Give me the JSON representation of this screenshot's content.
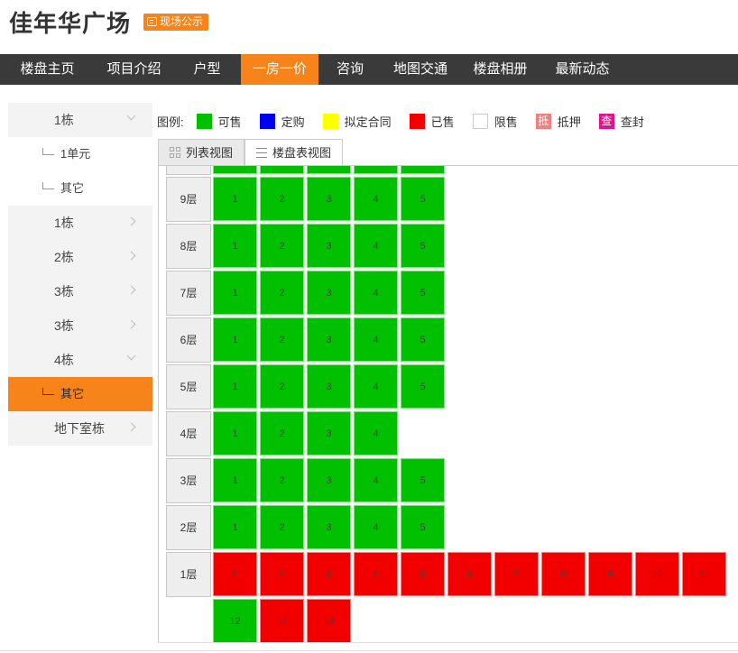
{
  "header": {
    "title": "佳年华广场",
    "badge": "现场公示"
  },
  "nav": [
    "楼盘主页",
    "项目介绍",
    "户型",
    "一房一价",
    "咨询",
    "地图交通",
    "楼盘相册",
    "最新动态"
  ],
  "sidebar": [
    {
      "label": "1栋",
      "type": "building",
      "chevron": "down"
    },
    {
      "label": "1单元",
      "type": "unit"
    },
    {
      "label": "其它",
      "type": "unit"
    },
    {
      "label": "1栋",
      "type": "building",
      "chevron": "right"
    },
    {
      "label": "2栋",
      "type": "building",
      "chevron": "right"
    },
    {
      "label": "3栋",
      "type": "building",
      "chevron": "right"
    },
    {
      "label": "3栋",
      "type": "building",
      "chevron": "right"
    },
    {
      "label": "4栋",
      "type": "building",
      "chevron": "down"
    },
    {
      "label": "其它",
      "type": "unit",
      "active": true
    },
    {
      "label": "地下室栋",
      "type": "building",
      "chevron": "right"
    }
  ],
  "legend": {
    "title": "图例:",
    "items": [
      {
        "label": "可售",
        "color": "#00c000"
      },
      {
        "label": "定购",
        "color": "#0000ee"
      },
      {
        "label": "拟定合同",
        "color": "#ffff00"
      },
      {
        "label": "已售",
        "color": "#f20000"
      },
      {
        "label": "限售",
        "color": "#ffffff"
      },
      {
        "label": "抵押",
        "color": "#f08080",
        "glyph": "抵"
      },
      {
        "label": "查封",
        "color": "#e0158a",
        "glyph": "查"
      }
    ]
  },
  "tabs": [
    "列表视图",
    "楼盘表视图"
  ],
  "floors": [
    {
      "label": "9层",
      "units": [
        {
          "n": "1",
          "s": "green"
        },
        {
          "n": "2",
          "s": "green"
        },
        {
          "n": "3",
          "s": "green"
        },
        {
          "n": "4",
          "s": "green"
        },
        {
          "n": "5",
          "s": "green"
        }
      ]
    },
    {
      "label": "8层",
      "units": [
        {
          "n": "1",
          "s": "green"
        },
        {
          "n": "2",
          "s": "green"
        },
        {
          "n": "3",
          "s": "green"
        },
        {
          "n": "4",
          "s": "green"
        },
        {
          "n": "5",
          "s": "green"
        }
      ]
    },
    {
      "label": "7层",
      "units": [
        {
          "n": "1",
          "s": "green"
        },
        {
          "n": "2",
          "s": "green"
        },
        {
          "n": "3",
          "s": "green"
        },
        {
          "n": "4",
          "s": "green"
        },
        {
          "n": "5",
          "s": "green"
        }
      ]
    },
    {
      "label": "6层",
      "units": [
        {
          "n": "1",
          "s": "green"
        },
        {
          "n": "2",
          "s": "green"
        },
        {
          "n": "3",
          "s": "green"
        },
        {
          "n": "4",
          "s": "green"
        },
        {
          "n": "5",
          "s": "green"
        }
      ]
    },
    {
      "label": "5层",
      "units": [
        {
          "n": "1",
          "s": "green"
        },
        {
          "n": "2",
          "s": "green"
        },
        {
          "n": "3",
          "s": "green"
        },
        {
          "n": "4",
          "s": "green"
        },
        {
          "n": "5",
          "s": "green"
        }
      ]
    },
    {
      "label": "4层",
      "units": [
        {
          "n": "1",
          "s": "green"
        },
        {
          "n": "2",
          "s": "green"
        },
        {
          "n": "3",
          "s": "green"
        },
        {
          "n": "4",
          "s": "green"
        }
      ]
    },
    {
      "label": "3层",
      "units": [
        {
          "n": "1",
          "s": "green"
        },
        {
          "n": "2",
          "s": "green"
        },
        {
          "n": "3",
          "s": "green"
        },
        {
          "n": "4",
          "s": "green"
        },
        {
          "n": "5",
          "s": "green"
        }
      ]
    },
    {
      "label": "2层",
      "units": [
        {
          "n": "1",
          "s": "green"
        },
        {
          "n": "2",
          "s": "green"
        },
        {
          "n": "3",
          "s": "green"
        },
        {
          "n": "4",
          "s": "green"
        },
        {
          "n": "5",
          "s": "green"
        }
      ]
    },
    {
      "label": "1层",
      "units": [
        {
          "n": "1",
          "s": "red"
        },
        {
          "n": "2",
          "s": "red"
        },
        {
          "n": "3",
          "s": "red"
        },
        {
          "n": "4",
          "s": "red"
        },
        {
          "n": "5",
          "s": "red"
        },
        {
          "n": "6",
          "s": "red"
        },
        {
          "n": "7",
          "s": "red"
        },
        {
          "n": "8",
          "s": "red"
        },
        {
          "n": "9",
          "s": "red"
        },
        {
          "n": "10",
          "s": "red"
        },
        {
          "n": "11",
          "s": "red"
        }
      ]
    },
    {
      "label": "",
      "units": [
        {
          "n": "12",
          "s": "green"
        },
        {
          "n": "13",
          "s": "red"
        },
        {
          "n": "14",
          "s": "red"
        }
      ]
    }
  ]
}
